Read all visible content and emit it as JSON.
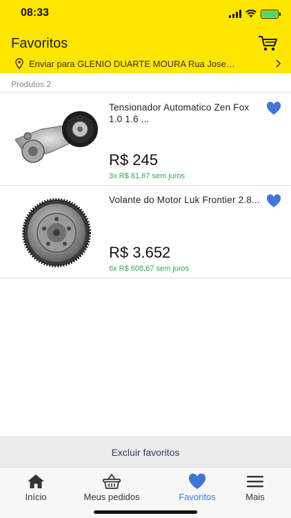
{
  "status": {
    "time": "08:33"
  },
  "header": {
    "title": "Favoritos",
    "cart_icon": "cart-icon",
    "shipping_text": "Enviar para GLENIO DUARTE MOURA Rua Jose…",
    "pin_icon": "location-pin-icon",
    "chevron_icon": "chevron-right-icon"
  },
  "list": {
    "count_label": "Produtos 2",
    "items": [
      {
        "name": "Tensionador Automatico Zen Fox 1.0 1.6 ...",
        "price": "R$ 245",
        "installments": "3x R$ 81,67 sem juros",
        "image_icon": "belt-tensioner-image",
        "favorite_icon": "heart-icon"
      },
      {
        "name": "Volante do Motor Luk Frontier 2.8...",
        "price": "R$ 3.652",
        "installments": "6x R$ 608,67 sem juros",
        "image_icon": "flywheel-image",
        "favorite_icon": "heart-icon"
      }
    ]
  },
  "actions": {
    "delete_label": "Excluir favoritos"
  },
  "tabbar": {
    "tabs": [
      {
        "label": "Início",
        "icon": "home-icon",
        "active": false
      },
      {
        "label": "Meus pedidos",
        "icon": "basket-icon",
        "active": false
      },
      {
        "label": "Favoritos",
        "icon": "heart-icon",
        "active": true
      },
      {
        "label": "Mais",
        "icon": "menu-icon",
        "active": false
      }
    ]
  },
  "colors": {
    "header_bg": "#FFE600",
    "accent_blue": "#3F76D8",
    "installments_green": "#2FA84F",
    "delete_bar_bg": "#ECECEC"
  }
}
